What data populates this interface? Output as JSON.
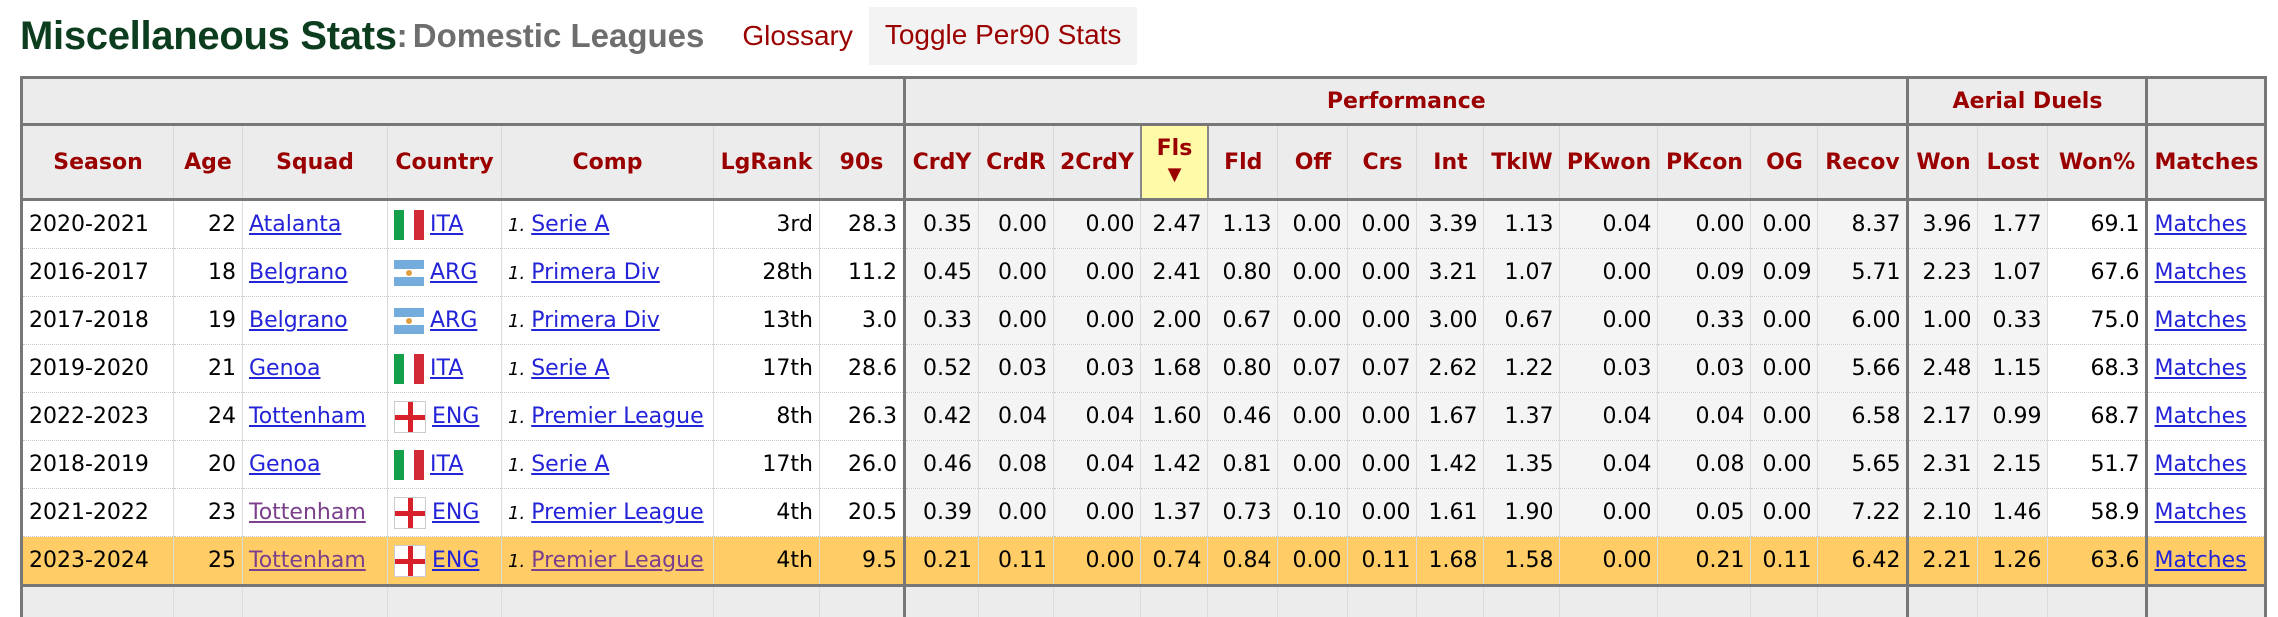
{
  "header": {
    "title": "Miscellaneous Stats",
    "separator": ":",
    "subtitle": "Domestic Leagues",
    "glossary_label": "Glossary",
    "toggle_label": "Toggle Per90 Stats"
  },
  "table": {
    "groups": {
      "performance": "Performance",
      "aerial": "Aerial Duels"
    },
    "columns": {
      "season": "Season",
      "age": "Age",
      "squad": "Squad",
      "country": "Country",
      "comp": "Comp",
      "lgrank": "LgRank",
      "n90s": "90s",
      "crdy": "CrdY",
      "crdr": "CrdR",
      "crdy2": "2CrdY",
      "fls": "Fls",
      "fld": "Fld",
      "off": "Off",
      "crs": "Crs",
      "int": "Int",
      "tklw": "TklW",
      "pkwon": "PKwon",
      "pkcon": "PKcon",
      "og": "OG",
      "recov": "Recov",
      "won": "Won",
      "lost": "Lost",
      "wonpct": "Won%",
      "matches": "Matches"
    },
    "sorted_column": "Fls",
    "sort_indicator": "▼",
    "highlight_color": "#ffcc66",
    "rows": [
      {
        "season": "2020-2021",
        "age": "22",
        "squad": "Atalanta",
        "flag": "italy-flag-icon",
        "country": "ITA",
        "tier": "1.",
        "comp": "Serie A",
        "lgrank": "3rd",
        "n90s": "28.3",
        "crdy": "0.35",
        "crdr": "0.00",
        "crdy2": "0.00",
        "fls": "2.47",
        "fld": "1.13",
        "off": "0.00",
        "crs": "0.00",
        "int": "3.39",
        "tklw": "1.13",
        "pkwon": "0.04",
        "pkcon": "0.00",
        "og": "0.00",
        "recov": "8.37",
        "won": "3.96",
        "lost": "1.77",
        "wonpct": "69.1",
        "matches": "Matches"
      },
      {
        "season": "2016-2017",
        "age": "18",
        "squad": "Belgrano",
        "flag": "argentina-flag-icon",
        "country": "ARG",
        "tier": "1.",
        "comp": "Primera Div",
        "lgrank": "28th",
        "n90s": "11.2",
        "crdy": "0.45",
        "crdr": "0.00",
        "crdy2": "0.00",
        "fls": "2.41",
        "fld": "0.80",
        "off": "0.00",
        "crs": "0.00",
        "int": "3.21",
        "tklw": "1.07",
        "pkwon": "0.00",
        "pkcon": "0.09",
        "og": "0.09",
        "recov": "5.71",
        "won": "2.23",
        "lost": "1.07",
        "wonpct": "67.6",
        "matches": "Matches"
      },
      {
        "season": "2017-2018",
        "age": "19",
        "squad": "Belgrano",
        "flag": "argentina-flag-icon",
        "country": "ARG",
        "tier": "1.",
        "comp": "Primera Div",
        "lgrank": "13th",
        "n90s": "3.0",
        "crdy": "0.33",
        "crdr": "0.00",
        "crdy2": "0.00",
        "fls": "2.00",
        "fld": "0.67",
        "off": "0.00",
        "crs": "0.00",
        "int": "3.00",
        "tklw": "0.67",
        "pkwon": "0.00",
        "pkcon": "0.33",
        "og": "0.00",
        "recov": "6.00",
        "won": "1.00",
        "lost": "0.33",
        "wonpct": "75.0",
        "matches": "Matches"
      },
      {
        "season": "2019-2020",
        "age": "21",
        "squad": "Genoa",
        "flag": "italy-flag-icon",
        "country": "ITA",
        "tier": "1.",
        "comp": "Serie A",
        "lgrank": "17th",
        "n90s": "28.6",
        "crdy": "0.52",
        "crdr": "0.03",
        "crdy2": "0.03",
        "fls": "1.68",
        "fld": "0.80",
        "off": "0.07",
        "crs": "0.07",
        "int": "2.62",
        "tklw": "1.22",
        "pkwon": "0.03",
        "pkcon": "0.03",
        "og": "0.00",
        "recov": "5.66",
        "won": "2.48",
        "lost": "1.15",
        "wonpct": "68.3",
        "matches": "Matches"
      },
      {
        "season": "2022-2023",
        "age": "24",
        "squad": "Tottenham",
        "flag": "england-flag-icon",
        "country": "ENG",
        "tier": "1.",
        "comp": "Premier League",
        "lgrank": "8th",
        "n90s": "26.3",
        "crdy": "0.42",
        "crdr": "0.04",
        "crdy2": "0.04",
        "fls": "1.60",
        "fld": "0.46",
        "off": "0.00",
        "crs": "0.00",
        "int": "1.67",
        "tklw": "1.37",
        "pkwon": "0.04",
        "pkcon": "0.04",
        "og": "0.00",
        "recov": "6.58",
        "won": "2.17",
        "lost": "0.99",
        "wonpct": "68.7",
        "matches": "Matches"
      },
      {
        "season": "2018-2019",
        "age": "20",
        "squad": "Genoa",
        "flag": "italy-flag-icon",
        "country": "ITA",
        "tier": "1.",
        "comp": "Serie A",
        "lgrank": "17th",
        "n90s": "26.0",
        "crdy": "0.46",
        "crdr": "0.08",
        "crdy2": "0.04",
        "fls": "1.42",
        "fld": "0.81",
        "off": "0.00",
        "crs": "0.00",
        "int": "1.42",
        "tklw": "1.35",
        "pkwon": "0.04",
        "pkcon": "0.08",
        "og": "0.00",
        "recov": "5.65",
        "won": "2.31",
        "lost": "2.15",
        "wonpct": "51.7",
        "matches": "Matches"
      },
      {
        "season": "2021-2022",
        "age": "23",
        "squad": "Tottenham",
        "squad_visited": true,
        "flag": "england-flag-icon",
        "country": "ENG",
        "tier": "1.",
        "comp": "Premier League",
        "lgrank": "4th",
        "n90s": "20.5",
        "crdy": "0.39",
        "crdr": "0.00",
        "crdy2": "0.00",
        "fls": "1.37",
        "fld": "0.73",
        "off": "0.10",
        "crs": "0.00",
        "int": "1.61",
        "tklw": "1.90",
        "pkwon": "0.00",
        "pkcon": "0.05",
        "og": "0.00",
        "recov": "7.22",
        "won": "2.10",
        "lost": "1.46",
        "wonpct": "58.9",
        "matches": "Matches"
      },
      {
        "season": "2023-2024",
        "age": "25",
        "squad": "Tottenham",
        "squad_visited": true,
        "comp_visited": true,
        "highlighted": true,
        "flag": "england-flag-icon",
        "country": "ENG",
        "tier": "1.",
        "comp": "Premier League",
        "lgrank": "4th",
        "n90s": "9.5",
        "crdy": "0.21",
        "crdr": "0.11",
        "crdy2": "0.00",
        "fls": "0.74",
        "fld": "0.84",
        "off": "0.00",
        "crs": "0.11",
        "int": "1.68",
        "tklw": "1.58",
        "pkwon": "0.00",
        "pkcon": "0.21",
        "og": "0.11",
        "recov": "6.42",
        "won": "2.21",
        "lost": "1.26",
        "wonpct": "63.6",
        "matches": "Matches"
      }
    ]
  }
}
